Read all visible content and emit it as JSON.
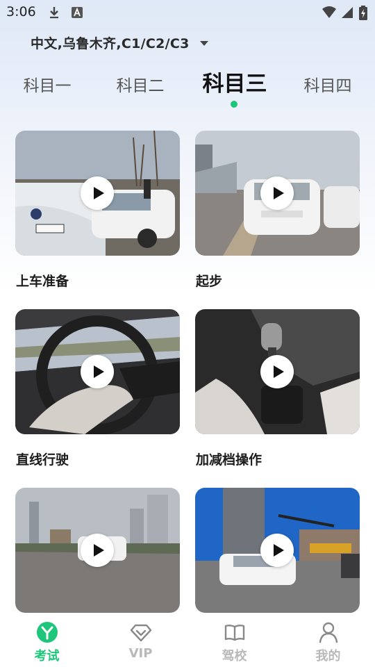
{
  "status_bar": {
    "time": "3:06",
    "icons": [
      "download-icon",
      "a-notification-icon",
      "wifi-icon",
      "cellular-icon",
      "battery-icon"
    ]
  },
  "region": {
    "label": "中文,乌鲁木齐,C1/C2/C3",
    "icon": "dropdown-triangle-icon"
  },
  "tabs": [
    {
      "label": "科目一",
      "active": false
    },
    {
      "label": "科目二",
      "active": false
    },
    {
      "label": "科目三",
      "active": true
    },
    {
      "label": "科目四",
      "active": false
    }
  ],
  "accent_color": "#1dc67a",
  "videos": [
    {
      "title": "上车准备",
      "icon": "play-icon"
    },
    {
      "title": "起步",
      "icon": "play-icon"
    },
    {
      "title": "直线行驶",
      "icon": "play-icon"
    },
    {
      "title": "加减档操作",
      "icon": "play-icon"
    },
    {
      "title": "",
      "icon": "play-icon"
    },
    {
      "title": "",
      "icon": "play-icon"
    }
  ],
  "bottom_nav": [
    {
      "label": "考试",
      "icon": "exam-icon",
      "active": true
    },
    {
      "label": "VIP",
      "icon": "vip-diamond-icon",
      "active": false
    },
    {
      "label": "驾校",
      "icon": "book-icon",
      "active": false
    },
    {
      "label": "我的",
      "icon": "profile-icon",
      "active": false
    }
  ]
}
